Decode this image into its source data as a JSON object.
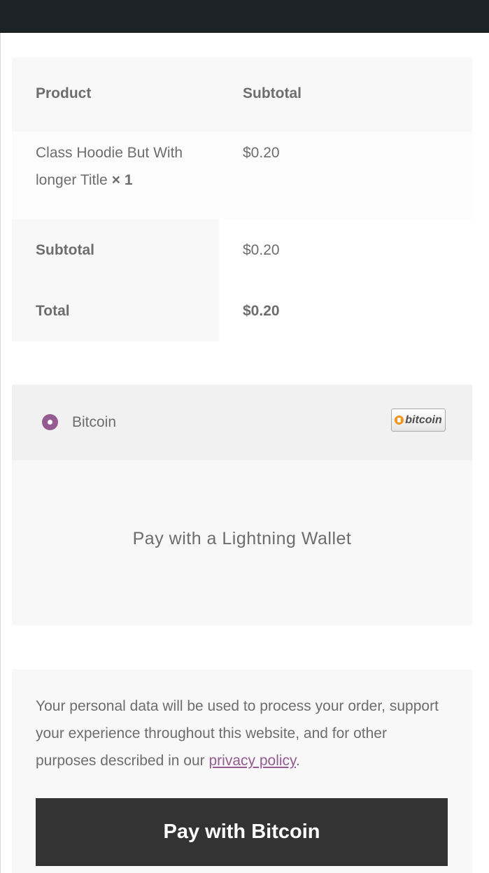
{
  "order_table": {
    "headers": {
      "product": "Product",
      "subtotal": "Subtotal"
    },
    "item": {
      "name": "Class Hoodie But With longer Title",
      "quantity": "× 1",
      "subtotal": "$0.20"
    },
    "subtotal": {
      "label": "Subtotal",
      "value": "$0.20"
    },
    "total": {
      "label": "Total",
      "value": "$0.20"
    }
  },
  "payment": {
    "method_label": "Bitcoin",
    "method_logo_text": "bitcoin",
    "method_logo_icon": "bitcoin-logo",
    "description": "Pay with a Lightning Wallet",
    "accent_color": "#955a8f"
  },
  "privacy": {
    "text_before": "Your personal data will be used to process your order, support your experience throughout this website, and for other purposes described in our ",
    "link_text": "privacy policy",
    "text_after": "."
  },
  "place_order_label": "Pay with Bitcoin"
}
